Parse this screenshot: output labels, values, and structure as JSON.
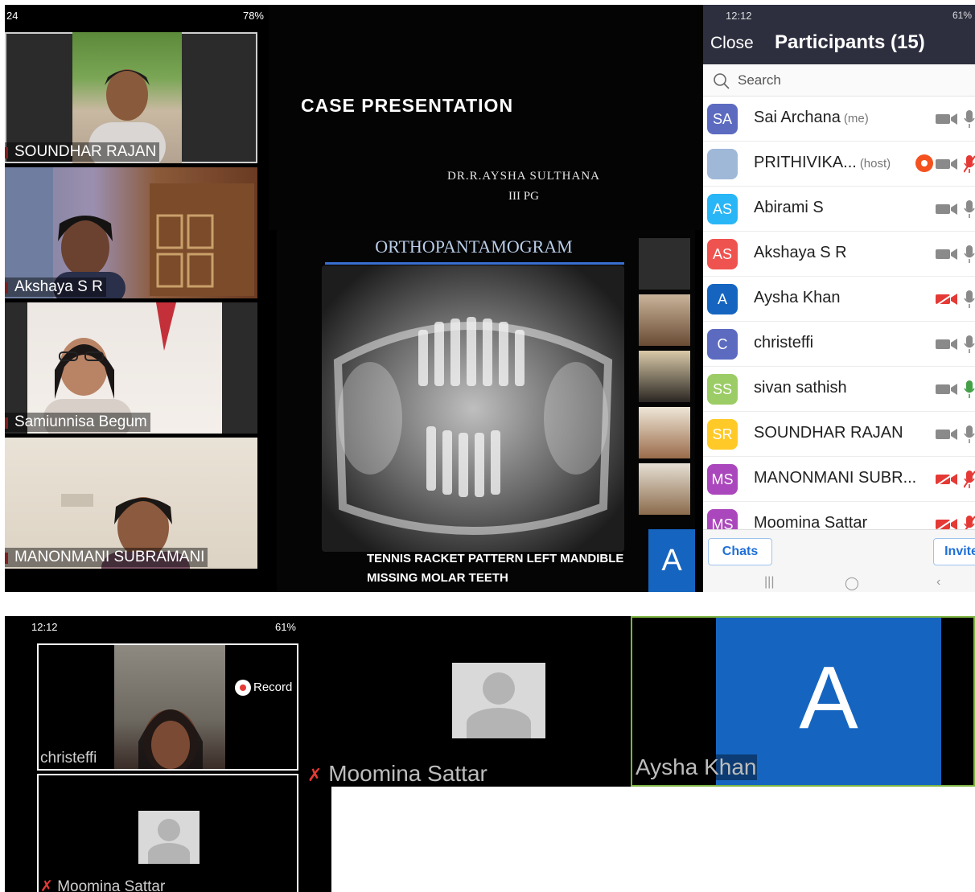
{
  "shot1": {
    "status_left": "24",
    "status_right": "78%",
    "tiles": [
      {
        "name": "SOUNDHAR RAJAN"
      },
      {
        "name": "Akshaya S R"
      },
      {
        "name": "Samiunnisa Begum"
      },
      {
        "name": "MANONMANI SUBRAMANI"
      }
    ]
  },
  "presentation": {
    "slide_title": "CASE PRESENTATION",
    "slide_author": "DR.R.AYSHA SULTHANA",
    "slide_level": "III PG",
    "opg_heading": "ORTHOPANTAMOGRAM",
    "caption_line1": "TENNIS RACKET PATTERN LEFT  MANDIBLE",
    "caption_line2": "MISSING MOLAR TEETH",
    "avatar_letter": "A"
  },
  "participants": {
    "status_time": "12:12",
    "status_battery": "61%",
    "close_label": "Close",
    "title": "Participants (15)",
    "search_placeholder": "Search",
    "list": [
      {
        "initials": "SA",
        "name": "Sai Archana",
        "tag": "(me)",
        "color": "#5c6bc0",
        "video_off": false,
        "mic_muted": false,
        "mic_active": false
      },
      {
        "initials": "",
        "name": "PRITHIVIKA...",
        "tag": "(host)",
        "color": "#9fb8d8",
        "video_off": false,
        "mic_muted": true,
        "recording": true
      },
      {
        "initials": "AS",
        "name": "Abirami S",
        "tag": "",
        "color": "#29b6f6",
        "video_off": false,
        "mic_muted": false
      },
      {
        "initials": "AS",
        "name": "Akshaya S R",
        "tag": "",
        "color": "#ef5350",
        "video_off": false,
        "mic_muted": false
      },
      {
        "initials": "A",
        "name": "Aysha Khan",
        "tag": "",
        "color": "#1565c0",
        "video_off": true,
        "mic_muted": false
      },
      {
        "initials": "C",
        "name": "christeffi",
        "tag": "",
        "color": "#5c6bc0",
        "video_off": false,
        "mic_muted": false
      },
      {
        "initials": "SS",
        "name": "sivan sathish",
        "tag": "",
        "color": "#9ccc65",
        "video_off": false,
        "mic_muted": false,
        "mic_active": true
      },
      {
        "initials": "SR",
        "name": "SOUNDHAR RAJAN",
        "tag": "",
        "color": "#ffca28",
        "video_off": false,
        "mic_muted": false
      },
      {
        "initials": "MS",
        "name": "MANONMANI SUBR...",
        "tag": "",
        "color": "#ab47bc",
        "video_off": true,
        "mic_muted": true
      },
      {
        "initials": "MS",
        "name": "Moomina Sattar",
        "tag": "",
        "color": "#ab47bc",
        "video_off": true,
        "mic_muted": true
      }
    ],
    "chats_label": "Chats",
    "invite_label": "Invite"
  },
  "shot4": {
    "status_time": "12:12",
    "status_battery": "61%",
    "recording_label": "Record",
    "tile1_name": "christeffi",
    "tile2_name": "Moomina Sattar"
  },
  "shot5": {
    "name": "Moomina Sattar"
  },
  "shot6": {
    "name_part1": "Aysha",
    "name_part2": "Khan",
    "avatar_letter": "A"
  }
}
